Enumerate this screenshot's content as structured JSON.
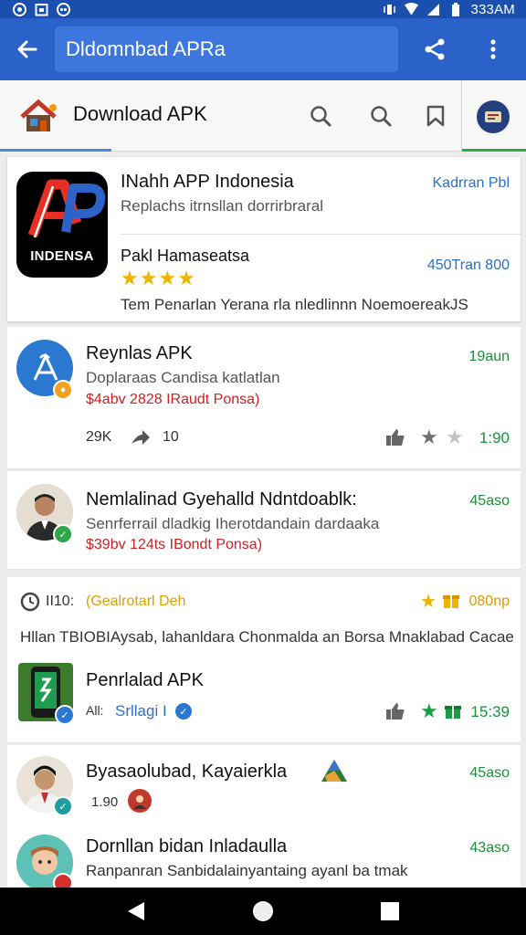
{
  "status_bar": {
    "time": "333AM",
    "icons": [
      "notification-icon",
      "calendar-icon",
      "sync-icon",
      "vibrate-icon",
      "wifi-icon",
      "signal-icon",
      "battery-icon"
    ]
  },
  "app_bar": {
    "url_text": "Dldomnbad APRa",
    "icons": [
      "back-arrow-icon",
      "share-icon",
      "more-vert-icon"
    ]
  },
  "site_header": {
    "title": "Download APK",
    "icons": [
      "house-logo-icon",
      "search-icon",
      "search-icon",
      "bookmark-icon",
      "profile-icon"
    ]
  },
  "featured": {
    "icon_text": "INDENSA",
    "title": "INahh APP Indonesia",
    "subtitle": "Replachs itrnsllan dorrirbraral",
    "top_right": "Kadrran Pbl",
    "name": "Pakl Hamaseatsa",
    "rating_stars": 4,
    "right_value": "450Tran 800",
    "description": "Tem Penarlan Yerana rla nledlinnn NoemoereakJS"
  },
  "items": [
    {
      "title": "Reynlas APK",
      "subtitle": "Doplaraas Candisa katlatlan",
      "price": "$4abv 2828 IRaudt Ponsa)",
      "time": "19aun",
      "stats_left": "29K",
      "stats_mid": "10",
      "stats_right": "1:90",
      "avatar_icon": "tools-icon"
    },
    {
      "title": "Nemlalinad Gyehalld Ndntdoablk:",
      "subtitle": "Senrferrail dladkig Iherotdandain dardaaka",
      "price": "$39bv 124ts IBondt Ponsa)",
      "time": "45aso",
      "avatar_icon": "person-photo"
    }
  ],
  "section": {
    "left_label": "II10:",
    "highlight": "(Gealrotarl Deh",
    "right_value": "080np",
    "banner": "Hllan TBIOBIAysab, lahanldara Chonmalda an Borsa Mnaklabad Cacae"
  },
  "items2": [
    {
      "title": "Penrlalad APK",
      "meta_left": "All:",
      "meta_link": "Srllagi I",
      "time": "15:39",
      "avatar_icon": "phone-app-icon"
    },
    {
      "title": "Byasaolubad, Kayaierkla",
      "meta_left": "1.90",
      "time": "45aso",
      "avatar_icon": "person-photo"
    },
    {
      "title": "Dornllan bidan Inladaulla",
      "subtitle": "Ranpanran Sanbidalainyantaing ayanl ba tmak",
      "time": "43aso",
      "avatar_icon": "cartoon-avatar"
    }
  ],
  "colors": {
    "status_bar": "#1a4fad",
    "app_bar": "#2a62c9",
    "accent_green": "#1d8d3c",
    "accent_blue": "#2e6fc4",
    "price_red": "#cc2222",
    "star_gold": "#f0b400"
  }
}
